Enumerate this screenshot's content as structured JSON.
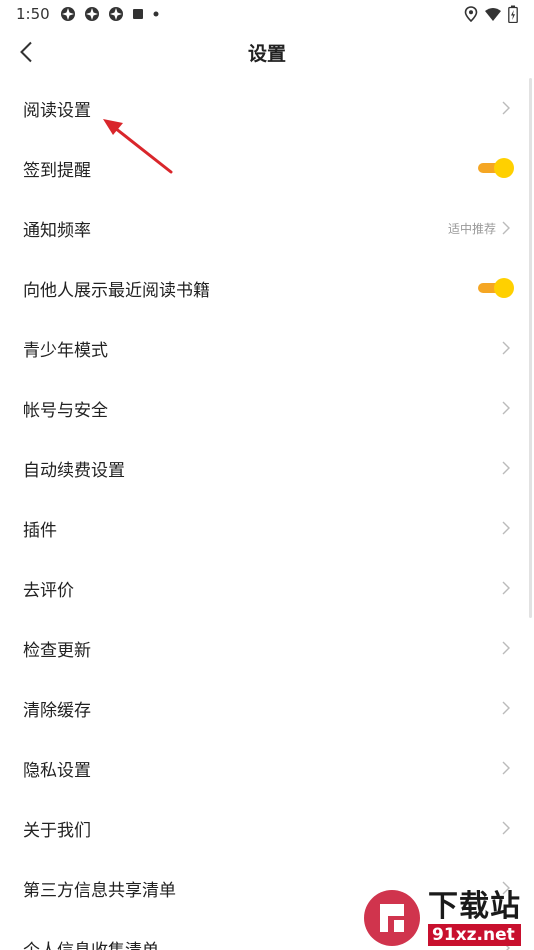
{
  "status_bar": {
    "time": "1:50",
    "notification_icons": [
      "pinwheel-icon",
      "pinwheel-icon",
      "pinwheel-icon",
      "square-icon",
      "dot-icon"
    ],
    "right_icons": [
      "location-icon",
      "wifi-icon",
      "battery-icon"
    ]
  },
  "header": {
    "title": "设置",
    "back_icon": "chevron-left-icon"
  },
  "settings": {
    "items": [
      {
        "label": "阅读设置",
        "control": "chevron"
      },
      {
        "label": "签到提醒",
        "control": "toggle",
        "on": true
      },
      {
        "label": "通知频率",
        "control": "chevron",
        "value": "适中推荐"
      },
      {
        "label": "向他人展示最近阅读书籍",
        "control": "toggle",
        "on": true
      },
      {
        "label": "青少年模式",
        "control": "chevron"
      },
      {
        "label": "帐号与安全",
        "control": "chevron"
      },
      {
        "label": "自动续费设置",
        "control": "chevron"
      },
      {
        "label": "插件",
        "control": "chevron"
      },
      {
        "label": "去评价",
        "control": "chevron"
      },
      {
        "label": "检查更新",
        "control": "chevron"
      },
      {
        "label": "清除缓存",
        "control": "chevron"
      },
      {
        "label": "隐私设置",
        "control": "chevron"
      },
      {
        "label": "关于我们",
        "control": "chevron"
      },
      {
        "label": "第三方信息共享清单",
        "control": "chevron"
      },
      {
        "label": "个人信息收集清单",
        "control": "chevron"
      }
    ]
  },
  "colors": {
    "toggle_track": "#f5a623",
    "toggle_knob": "#ffd000",
    "annotation_arrow": "#d9262b",
    "watermark_red": "#c8102e"
  },
  "watermark": {
    "text": "下载站",
    "url": "91xz.net"
  }
}
